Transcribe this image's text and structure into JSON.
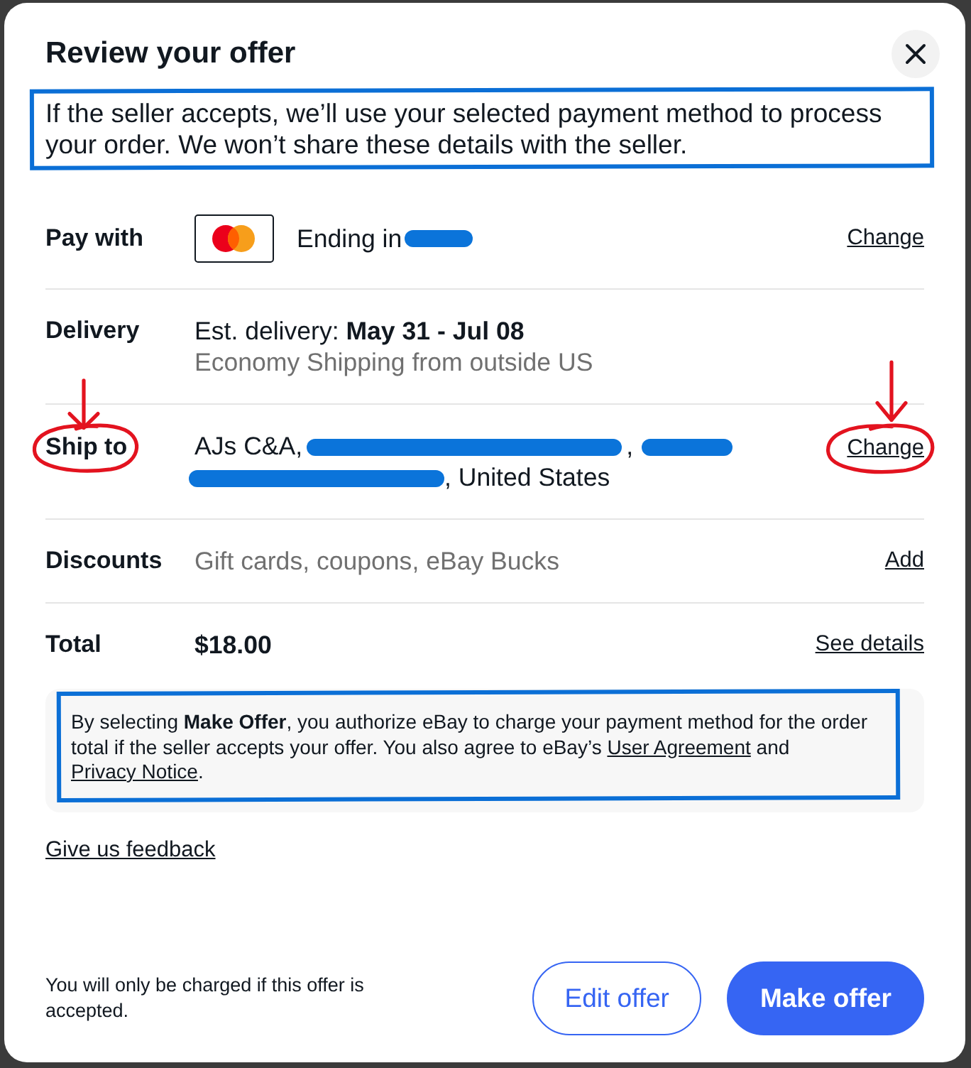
{
  "dialog": {
    "title": "Review your offer"
  },
  "notice": {
    "text": "If the seller accepts, we’ll use your selected payment method to process your order. We won’t share these details with the seller.",
    "outlined": true
  },
  "rows": [
    {
      "kind": "payment",
      "label": "Pay with",
      "value": "Ending in",
      "redacted": true,
      "action": "Change"
    },
    {
      "kind": "delivery",
      "label": "Delivery",
      "value": "Est. delivery: **May 31 - Jul 08**",
      "detail": "Economy Shipping from outside US"
    },
    {
      "kind": "address",
      "label": "Ship to",
      "label_circled": true,
      "address_lines": [
        [
          {
            "kind": "text",
            "text": "AJs C&A,"
          },
          {
            "kind": "redacted"
          },
          {
            "kind": "text",
            "text": ","
          },
          {
            "kind": "redacted"
          }
        ],
        [
          {
            "kind": "redacted"
          },
          {
            "kind": "text",
            "text": ", United States"
          }
        ]
      ],
      "action": "Change",
      "action_circled": true
    },
    {
      "kind": "discounts",
      "label": "Discounts",
      "value": "Gift cards, coupons, eBay Bucks",
      "action": "Add"
    },
    {
      "kind": "total",
      "label": "Total",
      "value": "$18.00",
      "action": "See details"
    }
  ],
  "legal": {
    "outlined": true,
    "parts": [
      {
        "kind": "text",
        "text": "By selecting **Make Offer**, you authorize eBay to charge your payment method for the order total if the seller accepts your offer. You also agree to eBay’s "
      },
      {
        "kind": "link",
        "text": "User Agreement"
      },
      {
        "kind": "text",
        "text": " and "
      },
      {
        "kind": "link",
        "text": "Privacy Notice"
      },
      {
        "kind": "text",
        "text": "."
      }
    ]
  },
  "feedback_link": "Give us feedback",
  "footer": {
    "note": "You will only be charged if this offer is accepted.",
    "buttons": [
      {
        "kind": "secondary",
        "label": "Edit offer"
      },
      {
        "kind": "primary",
        "label": "Make offer"
      }
    ]
  }
}
